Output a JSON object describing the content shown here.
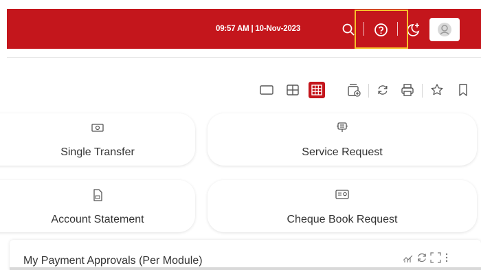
{
  "header": {
    "datetime": "09:57 AM | 10-Nov-2023",
    "brand_color": "#c4161c",
    "icons": [
      "search-icon",
      "help-icon",
      "theme-toggle-icon",
      "user-avatar-icon"
    ],
    "highlight_color": "#f7c12b"
  },
  "toolbar": {
    "icons": [
      "single-layout-icon",
      "two-column-layout-icon",
      "grid-layout-icon",
      "add-widget-icon",
      "refresh-icon",
      "print-icon",
      "favorite-icon",
      "bookmark-icon"
    ]
  },
  "quick_links": [
    {
      "label": "Single Transfer",
      "icon": "money-icon"
    },
    {
      "label": "Service Request",
      "icon": "service-request-icon"
    },
    {
      "label": "Account Statement",
      "icon": "statement-icon"
    },
    {
      "label": "Cheque Book Request",
      "icon": "cheque-book-icon"
    }
  ],
  "widget": {
    "title": "My Payment Approvals (Per Module)",
    "icons": [
      "chart-icon",
      "refresh-icon",
      "expand-icon",
      "more-icon"
    ]
  }
}
